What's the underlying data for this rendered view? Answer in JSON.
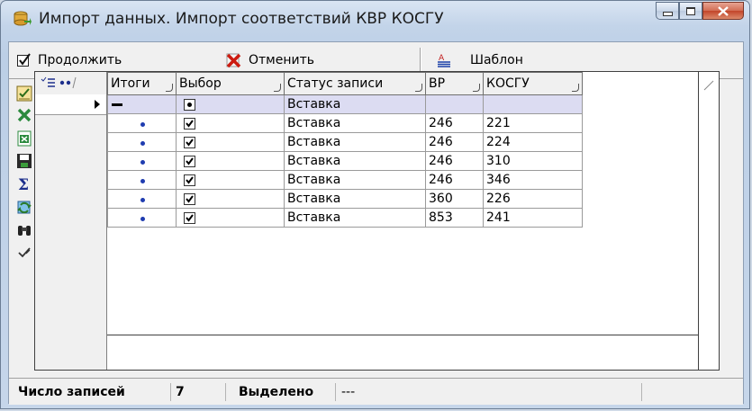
{
  "window": {
    "title": "Импорт данных. Импорт соответствий КВР КОСГУ"
  },
  "toolbar": {
    "continue_label": "Продолжить",
    "cancel_label": "Отменить",
    "template_label": "Шаблон"
  },
  "left_toolbar": {
    "icons": [
      "checklist-icon",
      "excel-icon",
      "excel-export-icon",
      "save-disk-icon",
      "sum-icon",
      "refresh-icon",
      "binoculars-search-icon",
      "check-mark-icon"
    ]
  },
  "grid": {
    "columns": [
      "Итоги",
      "Выбор",
      "Статус записи",
      "ВР",
      "КОСГУ"
    ],
    "summary_row": {
      "status": "Вставка"
    },
    "rows": [
      {
        "status": "Вставка",
        "vr": "246",
        "kosgu": "221"
      },
      {
        "status": "Вставка",
        "vr": "246",
        "kosgu": "224"
      },
      {
        "status": "Вставка",
        "vr": "246",
        "kosgu": "310"
      },
      {
        "status": "Вставка",
        "vr": "246",
        "kosgu": "346"
      },
      {
        "status": "Вставка",
        "vr": "360",
        "kosgu": "226"
      },
      {
        "status": "Вставка",
        "vr": "853",
        "kosgu": "241"
      }
    ]
  },
  "status": {
    "count_label": "Число записей",
    "count_value": "7",
    "selected_label": "Выделено",
    "selected_value": "---"
  },
  "colors": {
    "selected_row": "#dcdcf2",
    "dot": "#1f3cb0"
  }
}
